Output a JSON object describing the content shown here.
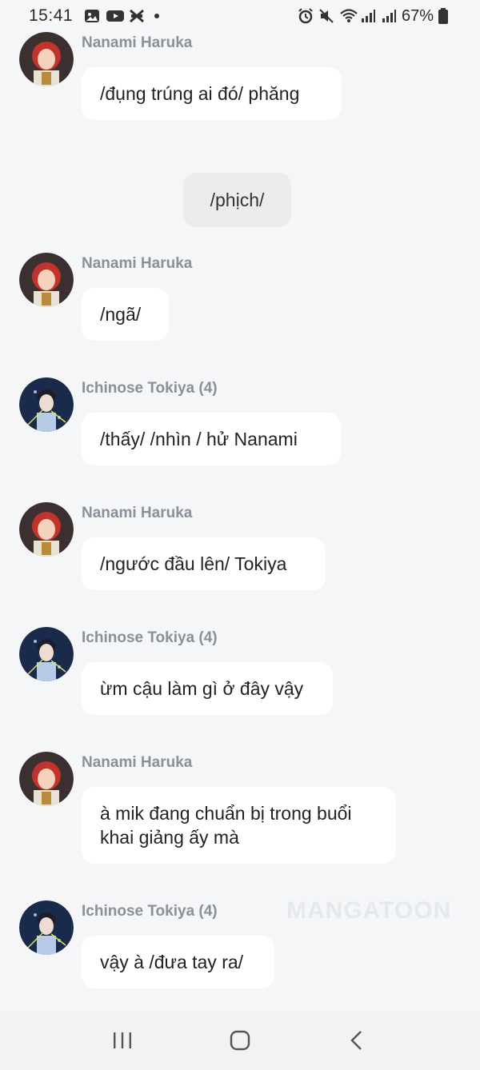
{
  "status_bar": {
    "time": "15:41",
    "battery": "67%",
    "left_icons": [
      "gallery-icon",
      "youtube-icon",
      "capcut-icon",
      "notification-dot"
    ],
    "right_icons": [
      "alarm-icon",
      "mute-icon",
      "wifi-icon",
      "signal-icon",
      "signal-icon",
      "battery-icon"
    ]
  },
  "messages": [
    {
      "sender": "Nanami Haruka",
      "text": "/đụng trúng ai đó/ phăng",
      "avatar": "nanami"
    },
    {
      "sender": "Nanami Haruka",
      "text": "/ngã/",
      "avatar": "nanami"
    },
    {
      "sender": "Ichinose Tokiya (4)",
      "text": "/thấy/ /nhìn / hử Nanami",
      "avatar": "tokiya"
    },
    {
      "sender": "Nanami Haruka",
      "text": "/ngước đầu lên/ Tokiya",
      "avatar": "nanami"
    },
    {
      "sender": "Ichinose Tokiya (4)",
      "text": "ừm cậu làm gì ở đây vậy",
      "avatar": "tokiya"
    },
    {
      "sender": "Nanami Haruka",
      "text": "à mik đang chuẩn bị trong buổi khai giảng ấy mà",
      "avatar": "nanami"
    },
    {
      "sender": "Ichinose Tokiya (4)",
      "text": "vậy à /đưa tay ra/",
      "avatar": "tokiya"
    }
  ],
  "system_message": "/phịch/",
  "watermark": "MANGATOON",
  "nav": {
    "recent": "recent-apps-icon",
    "home": "home-icon",
    "back": "back-icon"
  }
}
